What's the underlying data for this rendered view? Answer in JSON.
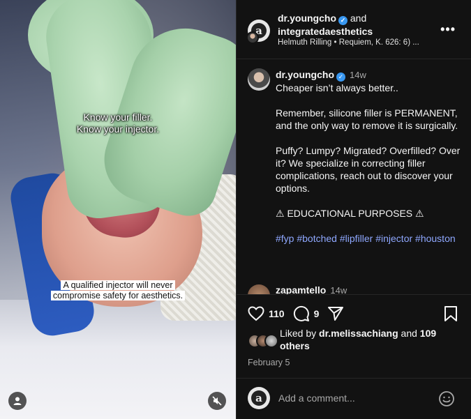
{
  "media": {
    "caption_top_line1": "Know your filler.",
    "caption_top_line2": "Know your injector.",
    "caption_bottom_line1": "A qualified injector will never",
    "caption_bottom_line2": "compromise safety for aesthetics."
  },
  "header": {
    "user1": "dr.youngcho",
    "and_text": "and",
    "user2": "integratedaesthetics",
    "audio": "Helmuth Rilling • Requiem, K. 626: 6) ..."
  },
  "caption": {
    "username": "dr.youngcho",
    "time": "14w",
    "p1": "Cheaper isn’t always better..",
    "p2": "Remember, silicone filler is PERMANENT, and the only way to remove it is surgically.",
    "p3": "Puffy? Lumpy? Migrated? Overfilled? Over it? We specialize in correcting filler complications, reach out to discover your options.",
    "p4": "⚠ EDUCATIONAL PURPOSES ⚠",
    "tags": [
      "#fyp",
      "#botched",
      "#lipfiller",
      "#injector",
      "#houston"
    ]
  },
  "next_comment": {
    "username": "zapamtello",
    "time": "14w"
  },
  "actions": {
    "like_count": "110",
    "comment_count": "9"
  },
  "likes": {
    "prefix": "Liked by",
    "user": "dr.melissachiang",
    "middle": "and",
    "others": "109 others"
  },
  "date": "February 5",
  "add_comment": {
    "placeholder": "Add a comment..."
  },
  "colors": {
    "panel_bg": "#121212",
    "hashtag": "#8fa8ff",
    "verified": "#3897f0"
  }
}
